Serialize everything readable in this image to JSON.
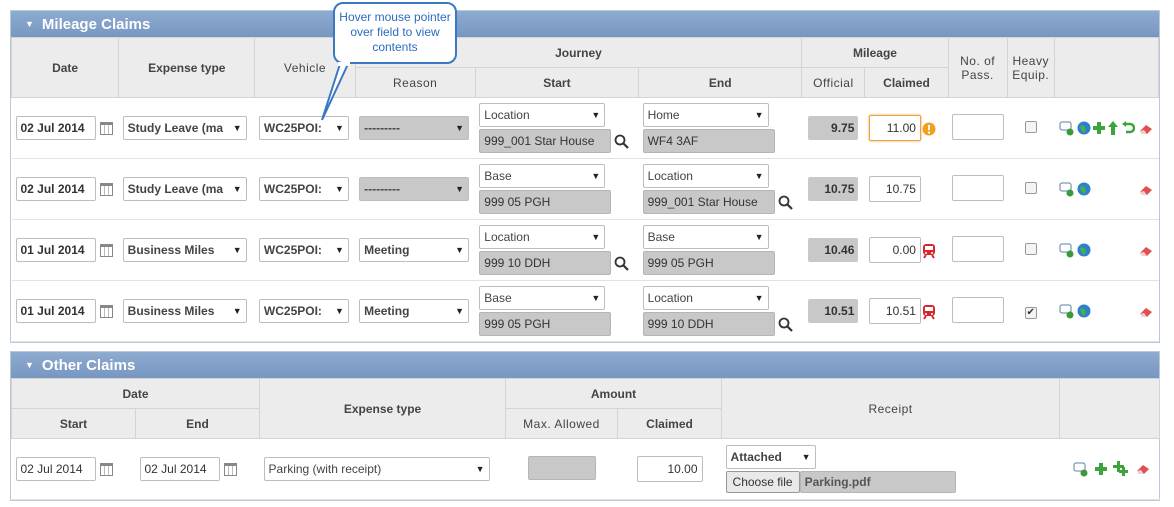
{
  "mileage": {
    "title": "Mileage Claims",
    "headers": {
      "date": "Date",
      "expense_type": "Expense type",
      "vehicle": "Vehicle",
      "journey": "Journey",
      "reason": "Reason",
      "start": "Start",
      "end": "End",
      "mileage": "Mileage",
      "official": "Official",
      "claimed": "Claimed",
      "no_pass": "No. of Pass.",
      "heavy": "Heavy Equip."
    },
    "rows": [
      {
        "date": "02 Jul 2014",
        "expense": "Study Leave (ma",
        "vehicle": "WC25POI:",
        "reason": "---------",
        "start_type": "Location",
        "start_val": "999_001 Star House",
        "end_type": "Home",
        "end_val": "WF4 3AF",
        "official": "9.75",
        "claimed": "11.00",
        "heavy": false
      },
      {
        "date": "02 Jul 2014",
        "expense": "Study Leave (ma",
        "vehicle": "WC25POI:",
        "reason": "---------",
        "start_type": "Base",
        "start_val": "999 05 PGH",
        "end_type": "Location",
        "end_val": "999_001 Star House",
        "official": "10.75",
        "claimed": "10.75",
        "heavy": false
      },
      {
        "date": "01 Jul 2014",
        "expense": "Business Miles",
        "vehicle": "WC25POI:",
        "reason": "Meeting",
        "start_type": "Location",
        "start_val": "999 10 DDH",
        "end_type": "Base",
        "end_val": "999 05 PGH",
        "official": "10.46",
        "claimed": "0.00",
        "heavy": false
      },
      {
        "date": "01 Jul 2014",
        "expense": "Business Miles",
        "vehicle": "WC25POI:",
        "reason": "Meeting",
        "start_type": "Base",
        "start_val": "999 05 PGH",
        "end_type": "Location",
        "end_val": "999 10 DDH",
        "official": "10.51",
        "claimed": "10.51",
        "heavy": true
      }
    ]
  },
  "callout": "Hover mouse pointer over field to view contents",
  "other": {
    "title": "Other Claims",
    "headers": {
      "date": "Date",
      "start": "Start",
      "end": "End",
      "expense_type": "Expense type",
      "amount": "Amount",
      "max_allowed": "Max. Allowed",
      "claimed": "Claimed",
      "receipt": "Receipt"
    },
    "row": {
      "start": "02 Jul 2014",
      "end": "02 Jul 2014",
      "expense": "Parking (with receipt)",
      "claimed": "10.00",
      "receipt_status": "Attached",
      "choose_file": "Choose file",
      "file_name": "Parking.pdf"
    }
  },
  "colors": {
    "header_bg": "#7f9ec8",
    "warning": "#f0a020",
    "train": "#d9262c"
  }
}
